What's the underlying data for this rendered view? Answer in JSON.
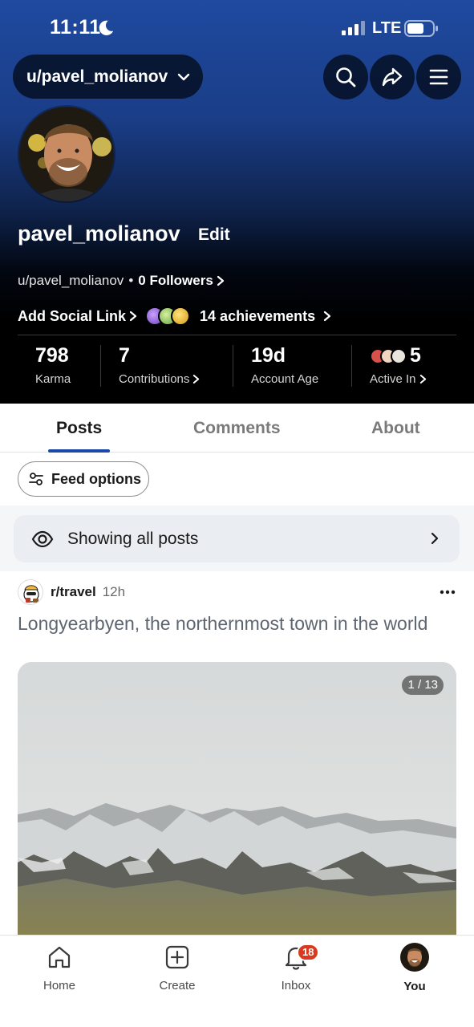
{
  "status_bar": {
    "time": "11:11",
    "network": "LTE"
  },
  "header": {
    "user_pill_label": "u/pavel_molianov",
    "actions": [
      "search-icon",
      "share-icon",
      "menu-icon"
    ]
  },
  "profile": {
    "display_name": "pavel_molianov",
    "edit_label": "Edit",
    "handle": "u/pavel_molianov",
    "dot": "•",
    "followers_label": "0 Followers",
    "add_social_link_label": "Add Social Link",
    "achievements_label": "14 achievements"
  },
  "stats": [
    {
      "value": "798",
      "label": "Karma"
    },
    {
      "value": "7",
      "label": "Contributions"
    },
    {
      "value": "19d",
      "label": "Account Age"
    },
    {
      "value": "5",
      "label": "Active In"
    }
  ],
  "tabs": [
    {
      "label": "Posts",
      "active": true
    },
    {
      "label": "Comments",
      "active": false
    },
    {
      "label": "About",
      "active": false
    }
  ],
  "feed_options_label": "Feed options",
  "filter_label": "Showing all posts",
  "post": {
    "subreddit": "r/travel",
    "time": "12h",
    "title": "Longyearbyen, the northernmost town in the world",
    "image_counter": "1 / 13"
  },
  "bottom_nav": [
    {
      "label": "Home",
      "icon": "home-icon"
    },
    {
      "label": "Create",
      "icon": "create-icon"
    },
    {
      "label": "Inbox",
      "icon": "bell-icon",
      "badge": "18"
    },
    {
      "label": "You",
      "icon": "avatar"
    }
  ],
  "colors": {
    "accent": "#1c49a8",
    "badge": "#d93a1f",
    "header_top": "#1f4aa0"
  }
}
